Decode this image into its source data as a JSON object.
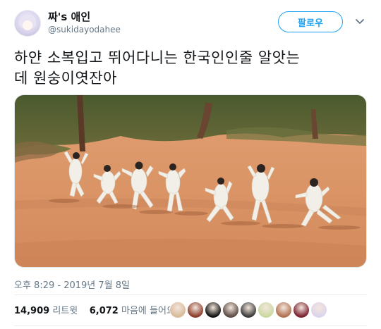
{
  "author": {
    "display_name": "짜's 애인",
    "handle": "@sukidayodahee"
  },
  "follow_button": {
    "label": "팔로우"
  },
  "tweet": {
    "line1": "하얀 소복입고 뛰어다니는 한국인인줄 알앗는",
    "line2": "데 원숭이엿잔아"
  },
  "media": {
    "kind": "photo"
  },
  "timestamp": "오후 8:29 - 2019년 7월 8일",
  "stats": {
    "retweets_count": "14,909",
    "retweets_label": "리트윗",
    "likes_count": "6,072",
    "likes_label": "마음에 들어요"
  },
  "likers": [
    {
      "color": "#d9b99a"
    },
    {
      "color": "#8a3b2a"
    },
    {
      "color": "#101010"
    },
    {
      "color": "#5c4a44"
    },
    {
      "color": "#3a3a3a"
    },
    {
      "color": "#c9d9a0"
    },
    {
      "color": "#b07050"
    },
    {
      "color": "#7a2030"
    },
    {
      "color": "#dcd4ee"
    }
  ],
  "colors": {
    "accent": "#1da1f2",
    "text": "#14171a",
    "muted": "#657786"
  },
  "icons": {
    "menu": "chevron-down-icon"
  }
}
